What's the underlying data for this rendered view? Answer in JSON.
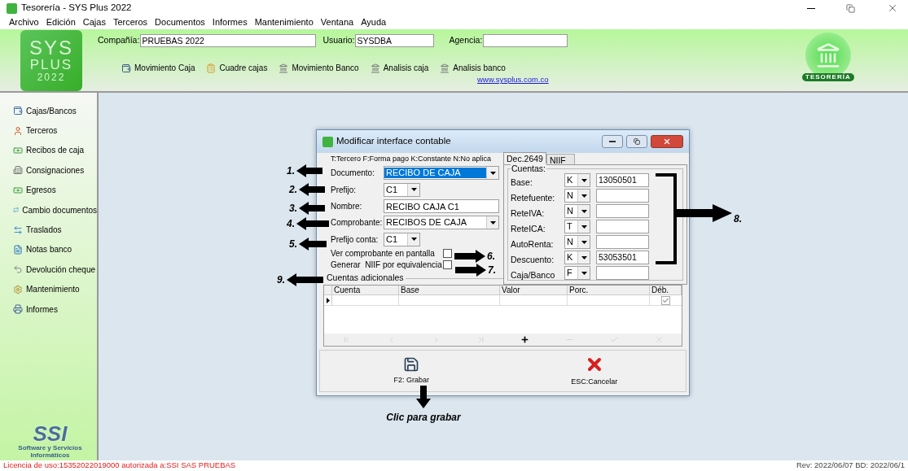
{
  "window": {
    "title": "Tesorería - SYS Plus 2022"
  },
  "menu": [
    "Archivo",
    "Edición",
    "Cajas",
    "Terceros",
    "Documentos",
    "Informes",
    "Mantenimiento",
    "Ventana",
    "Ayuda"
  ],
  "header": {
    "logo": [
      "SYS",
      "PLUS",
      "2022"
    ],
    "fields": [
      {
        "label": "Compañía:",
        "value": "PRUEBAS 2022"
      },
      {
        "label": "Usuario:",
        "value": "SYSDBA"
      },
      {
        "label": "Agencia:"
      }
    ],
    "toolbar": [
      "Movimiento Caja",
      "Cuadre cajas",
      "Movimiento Banco",
      "Analisis caja",
      "Analisis banco"
    ],
    "link": "www.sysplus.com.co",
    "badge": "TESORERÍA"
  },
  "sidebar": {
    "items": [
      "Cajas/Bancos",
      "Terceros",
      "Recibos de caja",
      "Consignaciones",
      "Egresos",
      "Cambio documentos",
      "Traslados",
      "Notas banco",
      "Devolución cheque",
      "Mantenimiento",
      "Informes"
    ],
    "footer_logo": "SSI",
    "footer_text": "Software y Servicios Informáticos"
  },
  "dialog": {
    "title": "Modificar interface contable",
    "legend": "T:Tercero F:Forma pago K:Constante N:No aplica",
    "fields": [
      {
        "kind": "select",
        "label": "Documento:",
        "value": "RECIBO DE CAJA",
        "highlighted": true
      },
      {
        "kind": "short_select",
        "label": "Prefijo:",
        "value": "C1",
        "highlighted": false
      },
      {
        "kind": "input",
        "label": "Nombre:",
        "value": "RECIBO CAJA C1"
      },
      {
        "kind": "select",
        "label": "Comprobante:",
        "value": "RECIBOS DE CAJA",
        "highlighted": false
      },
      {
        "kind": "short_select",
        "label": "Prefijo conta:",
        "value": "C1",
        "highlighted": false
      }
    ],
    "checkboxes": [
      {
        "label": "Ver comprobante en pantalla",
        "checked": false
      },
      {
        "label": "Generar  NIIF por equivalencia",
        "checked": false
      }
    ],
    "tabs": [
      {
        "label": "Dec.2649",
        "selected": true
      },
      {
        "label": "NIIF",
        "selected": false
      }
    ],
    "cuentas": {
      "title": "Cuentas:",
      "rows": [
        {
          "label": "Base:",
          "type": "K",
          "account": "13050501"
        },
        {
          "label": "Retefuente:",
          "type": "N"
        },
        {
          "label": "ReteIVA:",
          "type": "N"
        },
        {
          "label": "ReteICA:",
          "type": "T"
        },
        {
          "label": "AutoRenta:",
          "type": "N"
        },
        {
          "label": "Descuento:",
          "type": "K",
          "account": "53053501"
        },
        {
          "label": "Caja/Banco",
          "type": "F"
        }
      ]
    },
    "grid": {
      "title": "Cuentas adicionales",
      "columns": [
        "Cuenta",
        "Base",
        "Valor",
        "Porc.",
        "Déb."
      ],
      "rows": [
        {
          "debit_checked": true
        }
      ],
      "navigator": [
        {
          "kind": "first",
          "disabled": true
        },
        {
          "kind": "prev",
          "disabled": true
        },
        {
          "kind": "next",
          "disabled": true
        },
        {
          "kind": "last",
          "disabled": true
        },
        {
          "kind": "insert",
          "disabled": false
        },
        {
          "kind": "delete",
          "disabled": true
        },
        {
          "kind": "post",
          "disabled": true
        },
        {
          "kind": "cancel",
          "disabled": true
        }
      ]
    },
    "buttons": [
      {
        "kind": "save",
        "label": "F2: Grabar"
      },
      {
        "kind": "cancel",
        "label": "ESC:Cancelar"
      }
    ]
  },
  "annotations": [
    {
      "kind": "left",
      "label": "1."
    },
    {
      "kind": "left",
      "label": "2."
    },
    {
      "kind": "left",
      "label": "3."
    },
    {
      "kind": "left",
      "label": "4."
    },
    {
      "kind": "left",
      "label": "5."
    },
    {
      "kind": "right",
      "label": "6."
    },
    {
      "kind": "right",
      "label": "7."
    },
    {
      "kind": "bracket",
      "label": "8."
    },
    {
      "kind": "left",
      "label": "9."
    },
    {
      "kind": "down",
      "label": "Clic para grabar"
    }
  ],
  "status_bar": {
    "license": "Licencia de uso:15352022019000 autorizada a:SSI SAS PRUEBAS",
    "revision": "Rev: 2022/06/07 BD: 2022/06/1"
  }
}
